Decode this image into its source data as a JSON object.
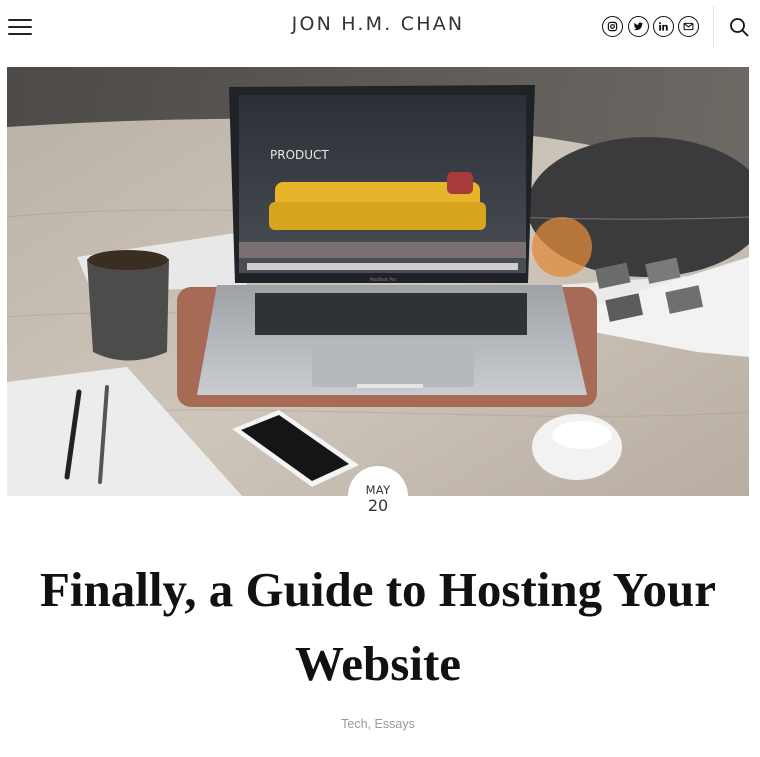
{
  "header": {
    "site_title": "JON H.M. CHAN",
    "menu_icon": "hamburger-menu-icon",
    "social_icons": [
      "instagram-icon",
      "twitter-icon",
      "linkedin-icon",
      "email-icon"
    ],
    "search_icon": "search-icon"
  },
  "hero": {
    "image_subject": "laptop on desk showing product website with yellow sofa",
    "screen_heading": "PRODUCT",
    "laptop_label": "MacBook Pro"
  },
  "post": {
    "date": {
      "month": "MAY",
      "day": "20"
    },
    "title": "Finally, a Guide to Hosting Your Website",
    "categories": [
      {
        "label": "Tech",
        "separator": ", "
      },
      {
        "label": "Essays",
        "separator": ""
      }
    ]
  },
  "colors": {
    "text": "#111111",
    "meta": "#9a9a9a",
    "background": "#ffffff"
  }
}
